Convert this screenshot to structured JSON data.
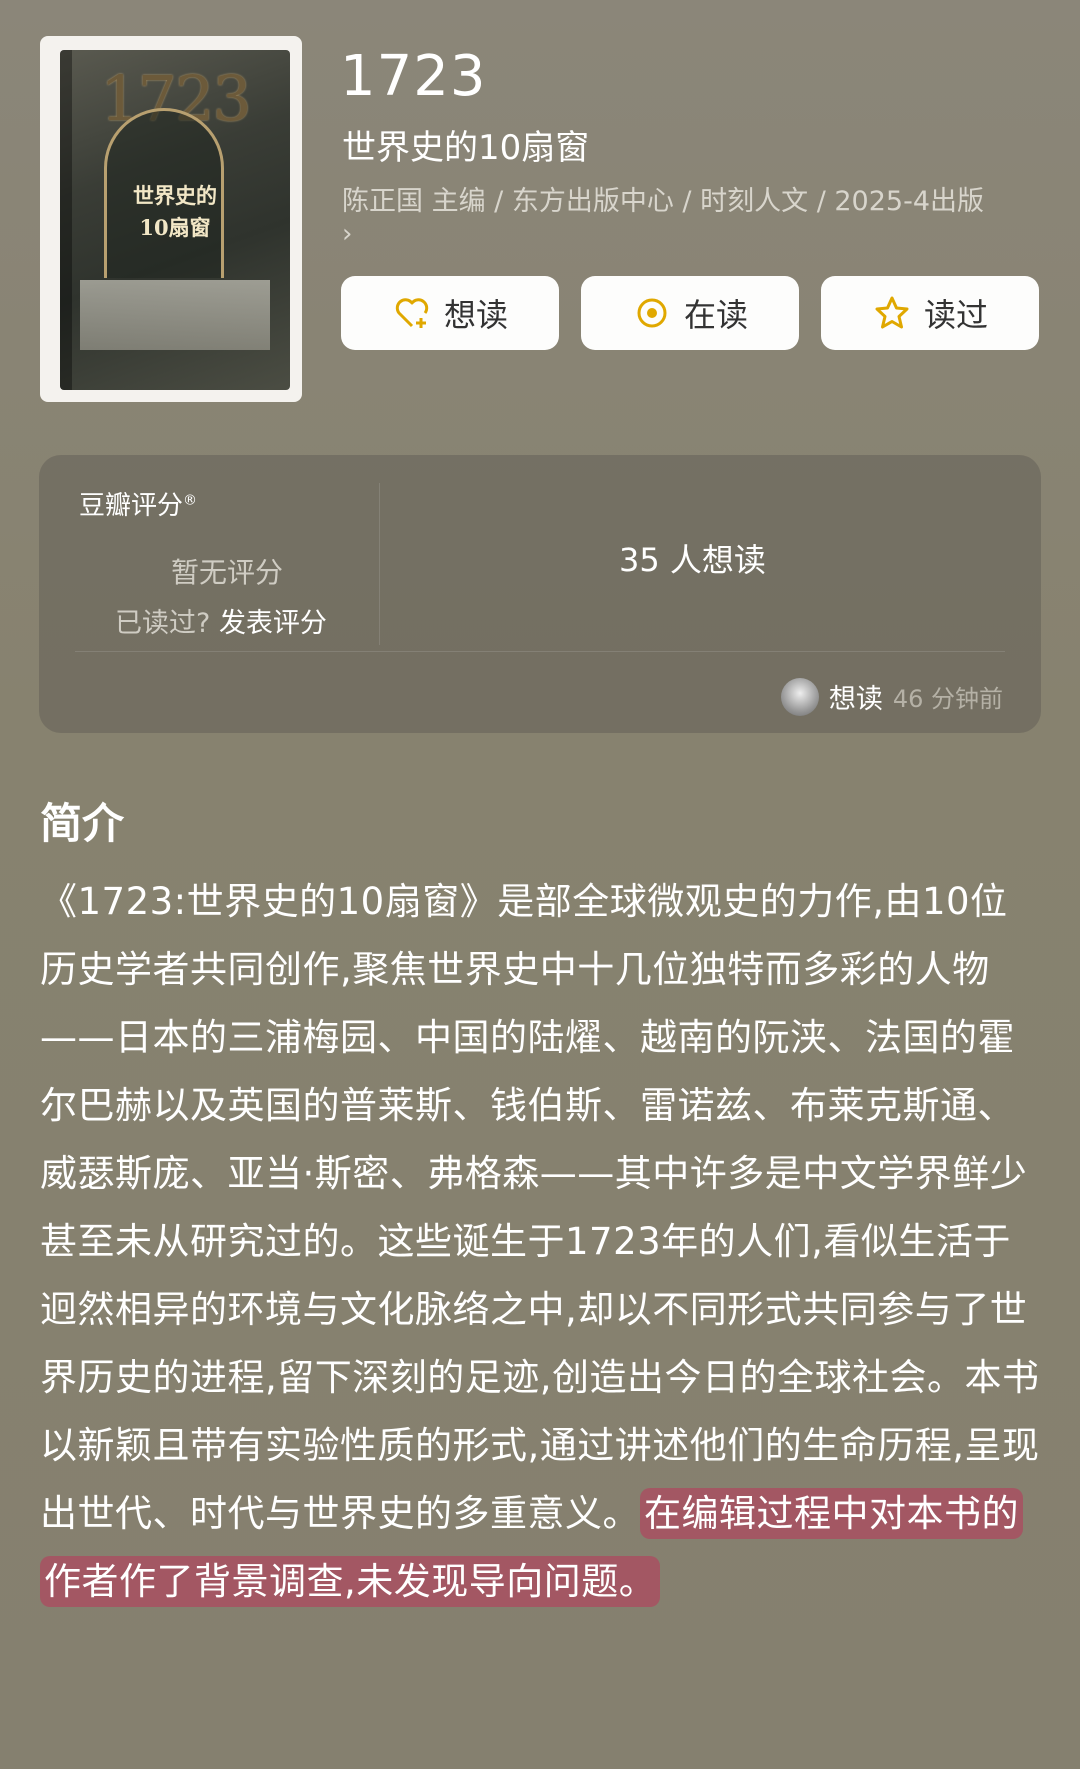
{
  "book": {
    "title": "1723",
    "subtitle": "世界史的10扇窗",
    "meta": "陈正国 主编 / 东方出版中心 / 时刻人文 / 2025-4出版",
    "meta_chevron": "›",
    "cover": {
      "year": "1723",
      "title_line1": "世界史的",
      "title_line2": "10扇窗"
    }
  },
  "actions": {
    "want": "想读",
    "reading": "在读",
    "read": "读过"
  },
  "rating": {
    "label": "豆瓣评分",
    "label_mark": "®",
    "no_rating": "暂无评分",
    "read_question": "已读过?",
    "post_rating": "发表评分",
    "want_count": "35 人想读",
    "activity_action": "想读",
    "activity_time": "46 分钟前"
  },
  "intro": {
    "title": "简介",
    "body": "《1723:世界史的10扇窗》是部全球微观史的力作,由10位历史学者共同创作,聚焦世界史中十几位独特而多彩的人物——日本的三浦梅园、中国的陆燿、越南的阮浃、法国的霍尔巴赫以及英国的普莱斯、钱伯斯、雷诺兹、布莱克斯通、威瑟斯庞、亚当·斯密、弗格森——其中许多是中文学界鲜少甚至未从研究过的。这些诞生于1723年的人们,看似生活于迥然相异的环境与文化脉络之中,却以不同形式共同参与了世界历史的进程,留下深刻的足迹,创造出今日的全球社会。本书以新颖且带有实验性质的形式,通过讲述他们的生命历程,呈现出世代、时代与世界史的多重意义。",
    "highlight": "在编辑过程中对本书的作者作了背景调查,未发现导向问题。"
  },
  "colors": {
    "background": "#8a8578",
    "highlight": "#b83c5c",
    "icon_accent": "#e0a800"
  }
}
